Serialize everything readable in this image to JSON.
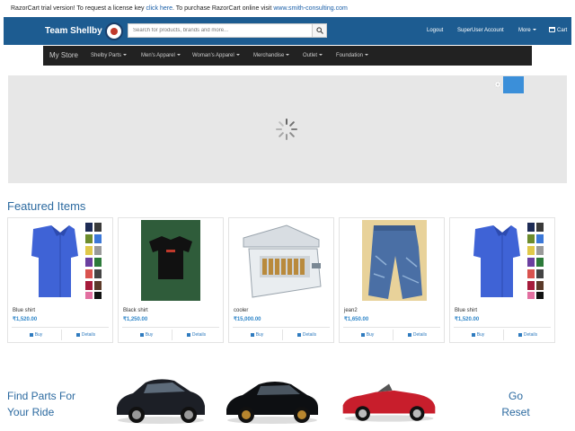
{
  "trial_notice": {
    "text_a": "RazorCart trial version! To request a license key ",
    "link_a": "click here",
    "text_b": ". To purchase RazorCart online visit ",
    "link_b": "www.smith-consulting.com"
  },
  "header": {
    "brand": "Team Shellby",
    "search_placeholder": "Search for products, brands and more...",
    "links": {
      "logout": "Logout",
      "account": "SuperUser Account",
      "more": "More",
      "cart": "Cart"
    }
  },
  "nav": {
    "store": "My Store",
    "items": [
      "Shelby Parts",
      "Men's Apparel",
      "Woman's Apparel",
      "Merchandise",
      "Outlet",
      "Foundation"
    ]
  },
  "featured": {
    "title": "Featured Items",
    "buy_label": "Buy",
    "details_label": "Details",
    "products": [
      {
        "name": "Blue shirt",
        "price": "₹1,520.00"
      },
      {
        "name": "Black shirt",
        "price": "₹1,250.00"
      },
      {
        "name": "cooler",
        "price": "₹15,000.00"
      },
      {
        "name": "jean2",
        "price": "₹1,650.00"
      },
      {
        "name": "Blue shirt",
        "price": "₹1,520.00"
      }
    ]
  },
  "finder": {
    "title_line1": "Find Parts For",
    "title_line2": "Your Ride",
    "go": "Go",
    "reset": "Reset"
  },
  "colors": {
    "header_bg": "#1d5c91",
    "nav_bg": "#222222",
    "accent": "#2c6aa0",
    "price": "#2f86c9"
  }
}
